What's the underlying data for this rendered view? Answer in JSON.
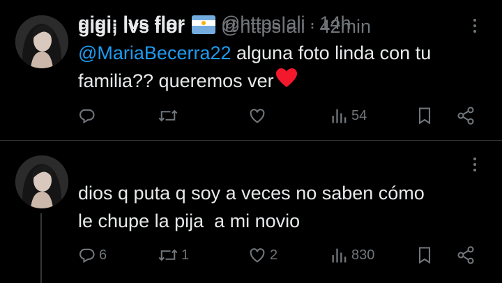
{
  "tweets": [
    {
      "author_name": "gigi; lvs flor",
      "flag_icon": "argentina-flag-icon",
      "handle": "@httpsIali",
      "separator": "·",
      "time": "42min",
      "mention": "@MariaBecerra22",
      "text_after_mention": " alguna foto linda con tu familia?? queremos ver",
      "emoji": "red-heart",
      "actions": {
        "replies": "",
        "reposts": "",
        "likes": "",
        "views": "54"
      }
    },
    {
      "author_name": "gigi; lvs flor",
      "flag_icon": "argentina-flag-icon",
      "handle": "@httpsIali",
      "separator": "·",
      "time": "14h",
      "text_line1": "dios q puta q soy a veces no saben cómo",
      "text_line2": "le chupe la pija  a mi novio",
      "actions": {
        "replies": "6",
        "reposts": "1",
        "likes": "2",
        "views": "830"
      }
    }
  ],
  "colors": {
    "background": "#000000",
    "text": "#e7e9ea",
    "muted": "#71767b",
    "link": "#1d9bf0",
    "divider": "#2f3336",
    "heart": "#f91880"
  }
}
